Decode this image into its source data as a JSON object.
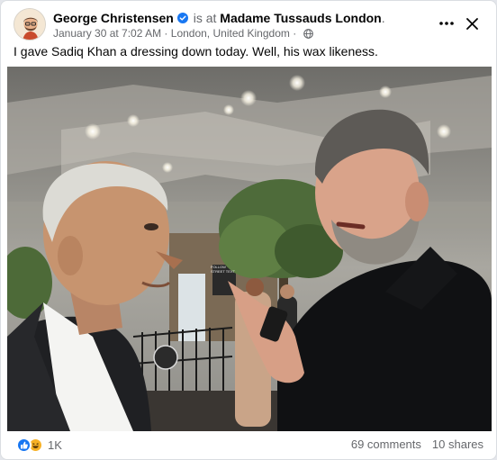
{
  "post": {
    "author": "George Christensen",
    "verified": true,
    "is_at_text": "is at",
    "location_name": "Madame Tussauds London",
    "date": "January 30 at 7:02 AM",
    "place_line": "London, United Kingdom",
    "privacy_icon": "globe-icon",
    "text": "I gave Sadiq Khan a dressing down today. Well, his wax likeness.",
    "sign_text": "FOLLOW\nSTREET TEXT",
    "reactions": {
      "icons": [
        "like-icon",
        "haha-icon"
      ],
      "count": "1K"
    },
    "comments": "69 comments",
    "shares": "10 shares"
  },
  "colors": {
    "accent": "#1877f2",
    "haha": "#f7b125",
    "secondary_text": "#65676b",
    "primary_text": "#050505"
  }
}
